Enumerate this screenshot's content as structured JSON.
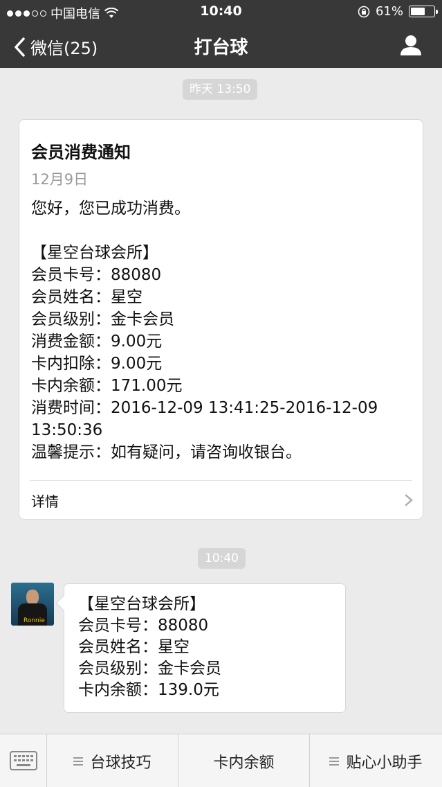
{
  "status_bar": {
    "carrier": "中国电信",
    "time": "10:40",
    "battery": "61%",
    "battery_level": 0.61
  },
  "nav": {
    "back_label": "微信(25)",
    "title": "打台球"
  },
  "timestamps": {
    "first": "昨天 13:50",
    "second": "10:40"
  },
  "card": {
    "title": "会员消费通知",
    "date": "12月9日",
    "greeting": "您好，您已成功消费。",
    "lines": [
      "【星空台球会所】",
      "会员卡号：88080",
      "会员姓名：星空",
      "会员级别：金卡会员",
      "消费金额：9.00元",
      "卡内扣除：9.00元",
      "卡内余额：171.00元",
      "消费时间：2016-12-09 13:41:25-2016-12-09",
      "13:50:36",
      "温馨提示：如有疑问，请咨询收银台。"
    ],
    "detail_label": "详情"
  },
  "message": {
    "avatar_caption": "Ronnie",
    "lines": [
      "【星空台球会所】",
      "会员卡号：88080",
      "会员姓名：星空",
      "会员级别：金卡会员",
      "卡内余额：139.0元"
    ]
  },
  "bottom_menu": {
    "items": [
      "台球技巧",
      "卡内余额",
      "贴心小助手"
    ]
  },
  "icons": {
    "back": "chevron-left-icon",
    "profile": "person-icon",
    "keyboard": "keyboard-icon",
    "detail": "chevron-right-icon",
    "menu": "hamburger-icon"
  }
}
